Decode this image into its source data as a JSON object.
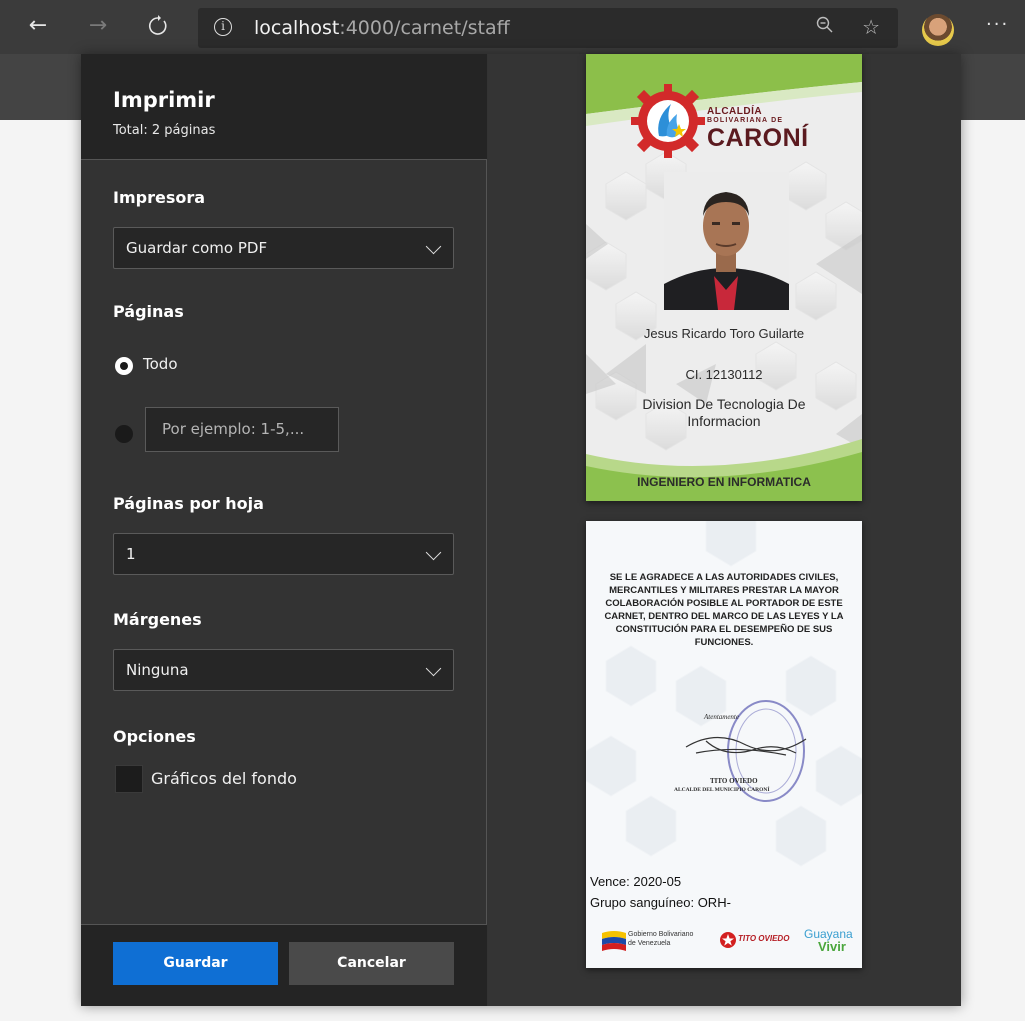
{
  "browser": {
    "url_host": "localhost",
    "url_rest": ":4000/carnet/staff"
  },
  "print": {
    "title": "Imprimir",
    "total": "Total: 2 páginas",
    "printer_label": "Impresora",
    "printer_value": "Guardar como PDF",
    "pages_label": "Páginas",
    "pages_all": "Todo",
    "pages_custom_placeholder": "Por ejemplo: 1-5,...",
    "per_sheet_label": "Páginas por hoja",
    "per_sheet_value": "1",
    "margins_label": "Márgenes",
    "margins_value": "Ninguna",
    "options_label": "Opciones",
    "background_graphics": "Gráficos del fondo",
    "save": "Guardar",
    "cancel": "Cancelar"
  },
  "card_front": {
    "brand_line1": "ALCALDÍA",
    "brand_line2": "BOLIVARIANA DE",
    "brand_line3": "CARONÍ",
    "name": "Jesus Ricardo Toro Guilarte",
    "id": "CI. 12130112",
    "division": "Division De Tecnologia De Informacion",
    "role": "INGENIERO EN INFORMATICA"
  },
  "card_back": {
    "notice": "SE LE AGRADECE A LAS AUTORIDADES CIVILES, MERCANTILES Y MILITARES PRESTAR LA MAYOR COLABORACIÓN POSIBLE AL PORTADOR DE ESTE CARNET, DENTRO DEL MARCO DE LAS LEYES Y LA CONSTITUCIÓN PARA EL DESEMPEÑO DE SUS FUNCIONES.",
    "sig_atentamente": "Atentamente",
    "sig_name": "TITO OVIEDO",
    "sig_title": "ALCALDE DEL MUNICIPIO CARONÍ",
    "expiry": "Vence: 2020-05",
    "blood": "Grupo sanguíneo: ORH-",
    "logo1_line1": "Gobierno Bolivariano",
    "logo1_line2": "de Venezuela",
    "logo2": "TITO OVIEDO",
    "logo3_line1": "Guayana",
    "logo3_line2": "Vivir"
  }
}
